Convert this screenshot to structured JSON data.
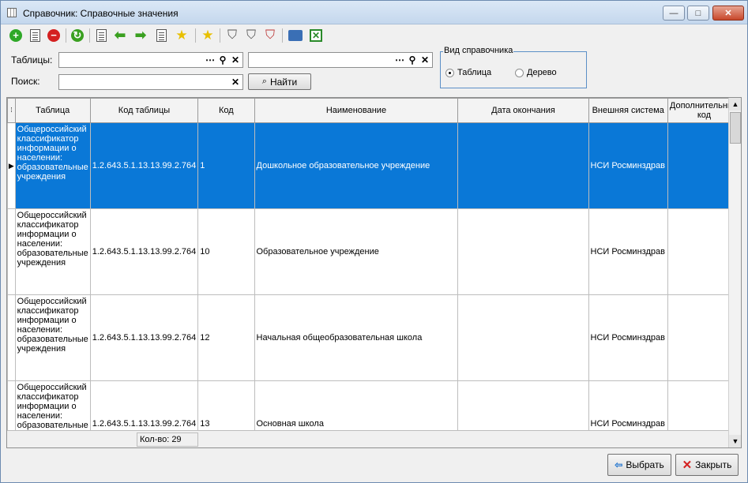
{
  "window": {
    "title": "Справочник: Справочные значения",
    "controls": {
      "minimize": "—",
      "maximize": "□",
      "close": "✕"
    }
  },
  "toolbar": {
    "icons": [
      "add-icon",
      "edit-icon",
      "delete-icon",
      "refresh-icon",
      "copy-icon",
      "arrow-left-icon",
      "arrow-right-icon",
      "copy-icon",
      "star-add-icon",
      "favorites-icon",
      "filter-icon",
      "filter-edit-icon",
      "filter-clear-icon",
      "print-icon",
      "excel-icon"
    ],
    "colors": {
      "add": "#2fa828",
      "delete": "#d42020",
      "refresh": "#3aa020",
      "arrow": "#3aa020",
      "star": "#e8c000"
    }
  },
  "filters": {
    "tables_label": "Таблицы:",
    "tables_value": "",
    "tables_value2": "",
    "search_label": "Поиск:",
    "search_value": "",
    "find_button": "Найти"
  },
  "view_type": {
    "legend": "Вид справочника",
    "options": [
      {
        "label": "Таблица",
        "selected": true
      },
      {
        "label": "Дерево",
        "selected": false
      }
    ]
  },
  "grid": {
    "columns": [
      "Таблица",
      "Код таблицы",
      "Код",
      "Наименование",
      "Дата окончания",
      "Внешняя система",
      "Дополнительный код"
    ],
    "rows": [
      {
        "table": "Общероссийский классификатор информации о населении: образовательные учреждения",
        "table_code": "1.2.643.5.1.13.13.99.2.764",
        "code": "1",
        "name": "Дошкольное образовательное учреждение",
        "end_date": "",
        "ext_system": "НСИ Росминздрав",
        "add_code": "",
        "selected": true
      },
      {
        "table": "Общероссийский классификатор информации о населении: образовательные учреждения",
        "table_code": "1.2.643.5.1.13.13.99.2.764",
        "code": "10",
        "name": "Образовательное учреждение",
        "end_date": "",
        "ext_system": "НСИ Росминздрав",
        "add_code": "",
        "selected": false
      },
      {
        "table": "Общероссийский классификатор информации о населении: образовательные учреждения",
        "table_code": "1.2.643.5.1.13.13.99.2.764",
        "code": "12",
        "name": "Начальная общеобразовательная школа",
        "end_date": "",
        "ext_system": "НСИ Росминздрав",
        "add_code": "",
        "selected": false
      },
      {
        "table": "Общероссийский классификатор информации о населении: образовательные учреждения",
        "table_code": "1.2.643.5.1.13.13.99.2.764",
        "code": "13",
        "name": "Основная школа",
        "end_date": "",
        "ext_system": "НСИ Росминздрав",
        "add_code": "",
        "selected": false
      }
    ],
    "count": "Кол-во: 29",
    "selection_color": "#0a78d7"
  },
  "buttons": {
    "select": "Выбрать",
    "close": "Закрыть"
  }
}
